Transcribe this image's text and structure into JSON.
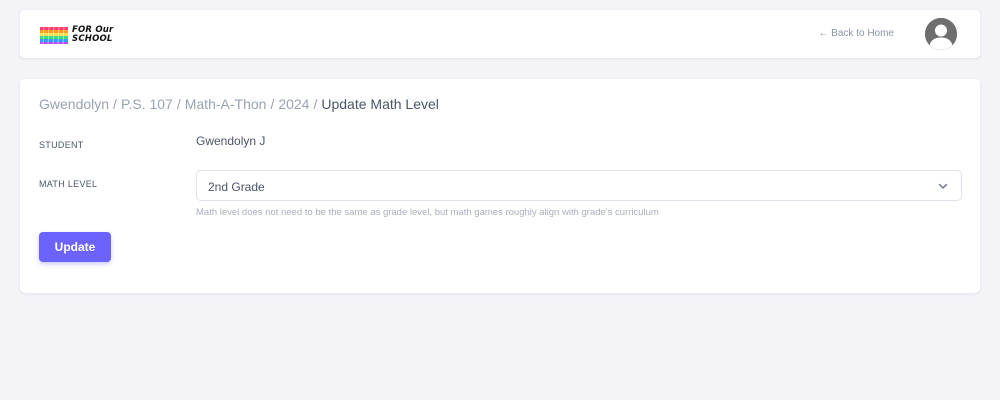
{
  "header": {
    "logo_line1": "FOR Our",
    "logo_line2": "SCHOOL",
    "back_link": "← Back to Home",
    "avatar_icon": "user-avatar-icon"
  },
  "breadcrumb": {
    "items": [
      "Gwendolyn",
      "P.S. 107",
      "Math-A-Thon",
      "2024"
    ],
    "separator": "/",
    "current": "Update Math Level"
  },
  "form": {
    "student_label": "STUDENT",
    "student_value": "Gwendolyn J",
    "math_level_label": "MATH LEVEL",
    "math_level_value": "2nd Grade",
    "math_level_help": "Math level does not need to be the same as grade level, but math games roughly align with grade's curriculum",
    "submit_label": "Update"
  },
  "colors": {
    "primary": "#6c63ff",
    "background": "#f3f3f8"
  }
}
